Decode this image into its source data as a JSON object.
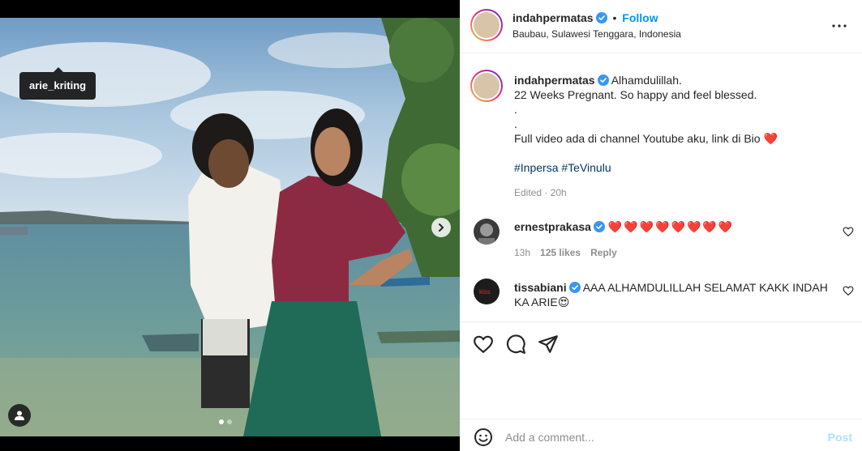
{
  "photo": {
    "tag_label": "arie_kriting",
    "icons": {
      "next": "chevron-right-icon",
      "tagged_user": "user-icon"
    },
    "carousel": {
      "count": 2,
      "active": 0
    }
  },
  "header": {
    "username": "indahpermatas",
    "separator": "•",
    "follow_label": "Follow",
    "location": "Baubau, Sulawesi Tenggara, Indonesia",
    "more_icon": "more-horizontal-icon"
  },
  "caption": {
    "username": "indahpermatas",
    "lines": [
      "Alhamdulillah.",
      "22 Weeks Pregnant. So happy and feel blessed.",
      ".",
      ".",
      "Full video ada di channel Youtube aku, link di Bio"
    ],
    "line5_emoji": "❤️",
    "hashtags": "#Inpersa #TeVinulu",
    "meta": "Edited · 20h"
  },
  "comments": [
    {
      "username": "ernestprakasa",
      "text": "❤️❤️❤️❤️❤️❤️❤️❤️",
      "time": "13h",
      "likes": "125 likes",
      "reply": "Reply"
    },
    {
      "username": "tissabiani",
      "text": "AAA ALHAMDULILLAH SELAMAT KAKK INDAH KA ARIE😍"
    }
  ],
  "actions": {
    "like_icon": "heart-icon",
    "comment_icon": "comment-icon",
    "share_icon": "send-icon"
  },
  "comment_bar": {
    "placeholder": "Add a comment...",
    "post_label": "Post",
    "emoji_icon": "smiley-icon"
  },
  "colors": {
    "accent": "#0095f6",
    "heart": "#ed4956",
    "verified": "#3897f0",
    "hashtag": "#00376b"
  }
}
